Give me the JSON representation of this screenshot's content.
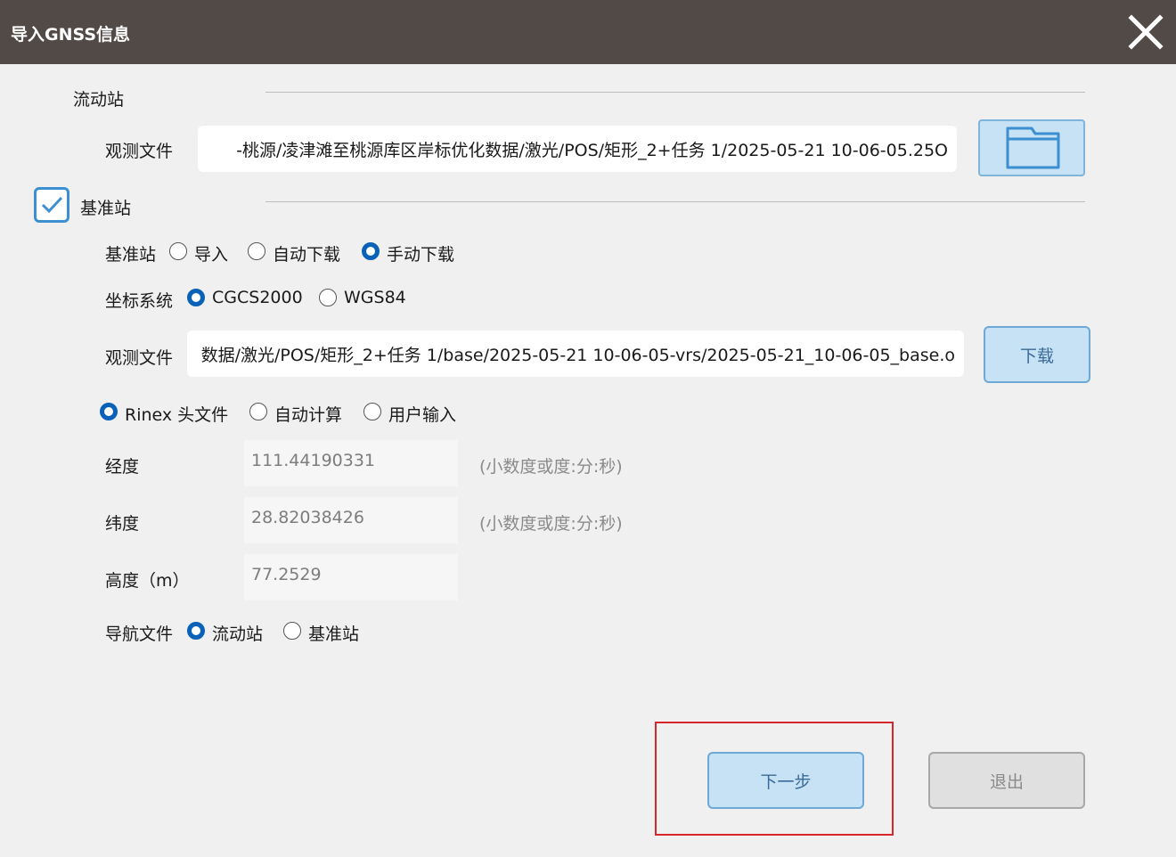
{
  "window": {
    "title": "导入GNSS信息"
  },
  "rover": {
    "section_label": "流动站",
    "obs_label": "观测文件",
    "obs_path": "-桃源/凌津滩至桃源库区岸标优化数据/激光/POS/矩形_2+任务 1/2025-05-21 10-06-05.25O"
  },
  "base": {
    "checkbox_checked": true,
    "section_label": "基准站",
    "source": {
      "label": "基准站",
      "options": [
        "导入",
        "自动下载",
        "手动下载"
      ],
      "selected": "手动下载"
    },
    "coord": {
      "label": "坐标系统",
      "options": [
        "CGCS2000",
        "WGS84"
      ],
      "selected": "CGCS2000"
    },
    "obs_label": "观测文件",
    "obs_path": "数据/激光/POS/矩形_2+任务 1/base/2025-05-21 10-06-05-vrs/2025-05-21_10-06-05_base.o",
    "download_label": "下载",
    "position_source": {
      "options": [
        "Rinex 头文件",
        "自动计算",
        "用户输入"
      ],
      "selected": "Rinex 头文件"
    },
    "longitude": {
      "label": "经度",
      "value": "111.44190331",
      "hint": "(小数度或度:分:秒)"
    },
    "latitude": {
      "label": "纬度",
      "value": "28.82038426",
      "hint": "(小数度或度:分:秒)"
    },
    "height": {
      "label": "高度（m）",
      "value": "77.2529"
    },
    "nav": {
      "label": "导航文件",
      "options": [
        "流动站",
        "基准站"
      ],
      "selected": "流动站"
    }
  },
  "buttons": {
    "next": "下一步",
    "exit": "退出"
  },
  "colors": {
    "titlebar": "#524a47",
    "accent": "#0a62b8",
    "button_fill": "#c6e2f4",
    "highlight": "#d9262c"
  }
}
